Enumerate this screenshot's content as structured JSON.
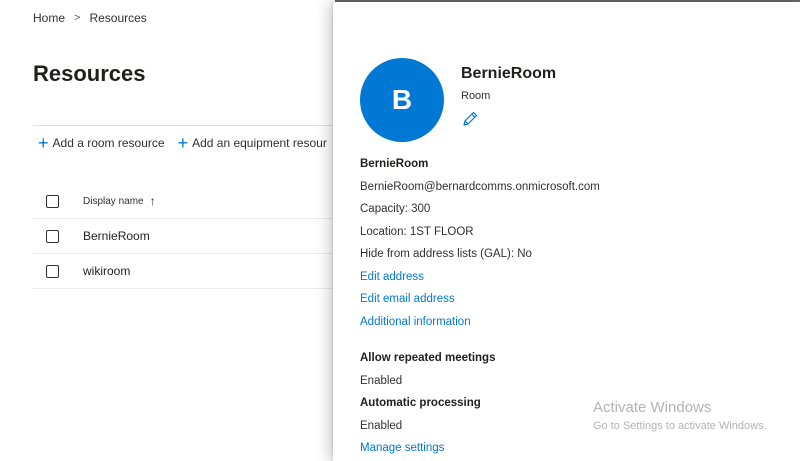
{
  "breadcrumb": {
    "home": "Home",
    "separator": ">",
    "current": "Resources"
  },
  "page": {
    "title": "Resources"
  },
  "commands": {
    "add_room": "Add a room resource",
    "add_equipment": "Add an equipment resour"
  },
  "table": {
    "header": {
      "display_name": "Display name",
      "sort_icon": "↑"
    },
    "rows": [
      {
        "display_name": "BernieRoom"
      },
      {
        "display_name": "wikiroom"
      }
    ]
  },
  "panel": {
    "avatar_initial": "B",
    "name": "BernieRoom",
    "type": "Room",
    "edit_icon": "pencil-icon",
    "details": {
      "heading": "BernieRoom",
      "email": "BernieRoom@bernardcomms.onmicrosoft.com",
      "capacity": "Capacity: 300",
      "location": "Location: 1ST FLOOR",
      "hide_gal": "Hide from address lists (GAL): No",
      "edit_address": "Edit address",
      "edit_email": "Edit email address",
      "additional_info": "Additional information"
    },
    "booking": {
      "repeated_label": "Allow repeated meetings",
      "repeated_value": "Enabled",
      "auto_label": "Automatic processing",
      "auto_value": "Enabled",
      "manage": "Manage settings"
    }
  },
  "watermark": {
    "title": "Activate Windows",
    "subtitle": "Go to Settings to activate Windows."
  },
  "colors": {
    "accent": "#0078d4",
    "text": "#323130",
    "divider": "#edebe9"
  }
}
